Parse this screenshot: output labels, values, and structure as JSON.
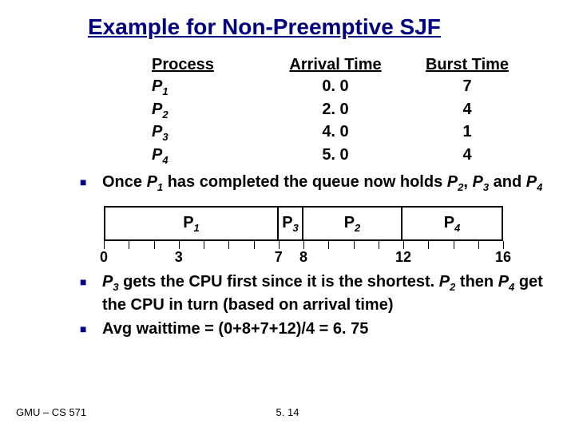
{
  "title": "Example for Non-Preemptive SJF",
  "table": {
    "headers": [
      "Process",
      "Arrival Time",
      "Burst Time"
    ],
    "rows": [
      {
        "p": "P",
        "sub": "1",
        "arrival": "0. 0",
        "burst": "7"
      },
      {
        "p": "P",
        "sub": "2",
        "arrival": "2. 0",
        "burst": "4"
      },
      {
        "p": "P",
        "sub": "3",
        "arrival": "4. 0",
        "burst": "1"
      },
      {
        "p": "P",
        "sub": "4",
        "arrival": "5. 0",
        "burst": "4"
      }
    ]
  },
  "bullet1_a": "Once ",
  "bullet1_p": "P",
  "bullet1_sub": "1",
  "bullet1_b": " has completed the queue now holds ",
  "bullet1_p2": "P",
  "bullet1_sub2": "2",
  "bullet1_c": ", ",
  "bullet1_p3": "P",
  "bullet1_sub3": "3",
  "bullet1_d": " and ",
  "bullet1_p4": "P",
  "bullet1_sub4": "4",
  "gantt": {
    "total": 16,
    "segments": [
      {
        "p": "P",
        "sub": "1",
        "start": 0,
        "end": 7
      },
      {
        "p": "P",
        "sub": "3",
        "start": 7,
        "end": 8
      },
      {
        "p": "P",
        "sub": "2",
        "start": 8,
        "end": 12
      },
      {
        "p": "P",
        "sub": "4",
        "start": 12,
        "end": 16
      }
    ],
    "tick_marks": [
      0,
      1,
      2,
      3,
      4,
      5,
      6,
      7,
      8,
      9,
      10,
      11,
      12,
      13,
      14,
      15,
      16
    ],
    "axis_labels": [
      {
        "at": 0,
        "text": "0"
      },
      {
        "at": 3,
        "text": "3"
      },
      {
        "at": 7,
        "text": "7"
      },
      {
        "at": 8,
        "text": "8"
      },
      {
        "at": 12,
        "text": "12"
      },
      {
        "at": 16,
        "text": "16"
      }
    ]
  },
  "bullet2_p3": "P",
  "bullet2_sub3": "3",
  "bullet2_a": " gets the CPU first since it is the shortest. ",
  "bullet2_p2": "P",
  "bullet2_sub2": "2",
  "bullet2_b": " then ",
  "bullet2_p4": "P",
  "bullet2_sub4": "4",
  "bullet2_c": " get the CPU in turn (based on arrival time)",
  "bullet3": "Avg waittime = (0+8+7+12)/4 = 6. 75",
  "footer_left": "GMU – CS 571",
  "footer_center": "5. 14"
}
